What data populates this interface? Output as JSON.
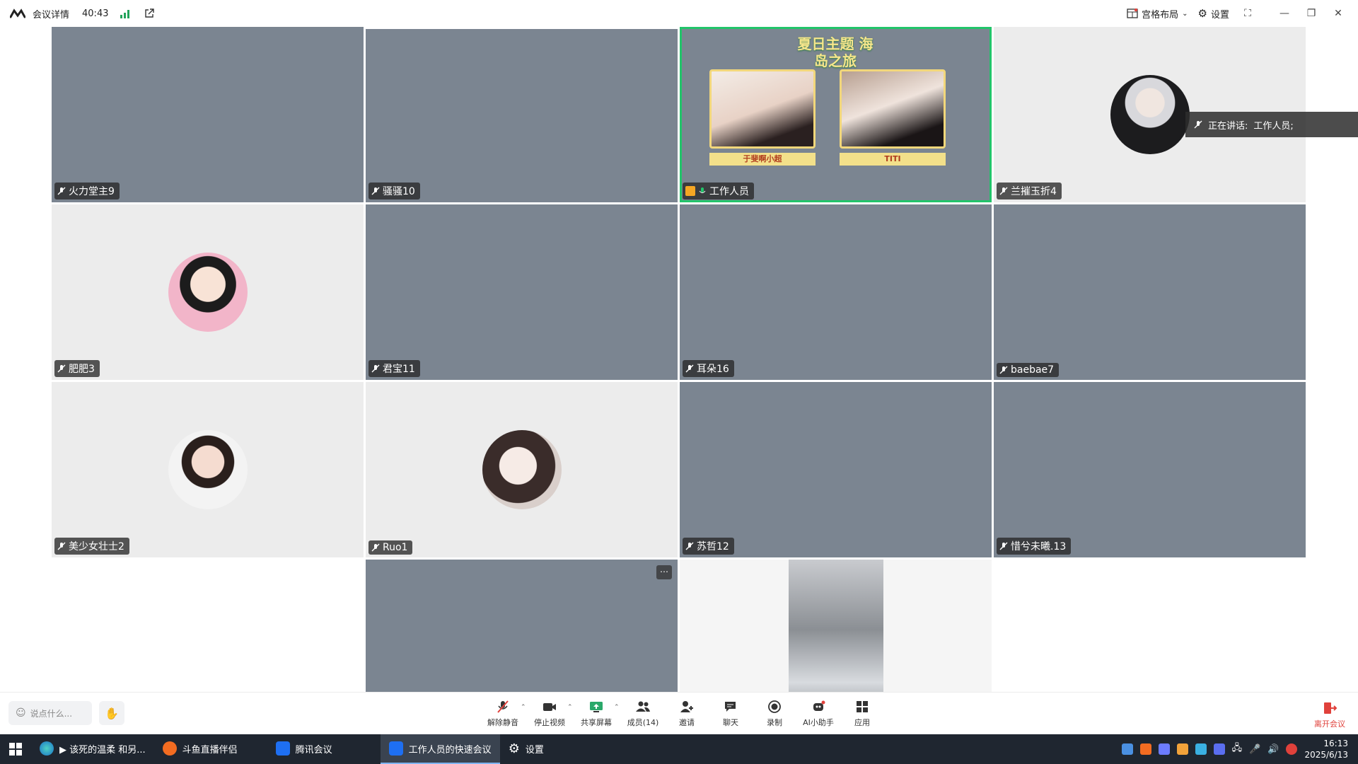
{
  "topbar": {
    "meeting_details_label": "会议详情",
    "elapsed_time": "40:43",
    "layout_label": "宫格布局",
    "settings_label": "设置"
  },
  "tiles": [
    {
      "name": "火力堂主9",
      "type": "video"
    },
    {
      "name": "骚骚10",
      "type": "video"
    },
    {
      "name": "工作人员",
      "type": "video",
      "active": true,
      "overlay": {
        "title": "夏日主题 海岛之旅",
        "left_label": "于斐啊小超",
        "right_label": "TITI"
      }
    },
    {
      "name": "兰摧玉折4",
      "type": "avatar"
    },
    {
      "name": "肥肥3",
      "type": "avatar"
    },
    {
      "name": "君宝11",
      "type": "video"
    },
    {
      "name": "耳朵16",
      "type": "video"
    },
    {
      "name": "baebae7",
      "type": "video"
    },
    {
      "name": "美少女壮士2",
      "type": "avatar"
    },
    {
      "name": "Ruo1",
      "type": "avatar"
    },
    {
      "name": "苏哲12",
      "type": "video"
    },
    {
      "name": "惜兮未曦.13",
      "type": "video"
    },
    {
      "name": "",
      "type": "video"
    },
    {
      "name": "",
      "type": "video"
    }
  ],
  "speaking_indicator": {
    "prefix": "正在讲话:",
    "speaker": "工作人员;"
  },
  "toolbar": {
    "chat_placeholder": "说点什么...",
    "tools": [
      {
        "label": "解除静音",
        "icon": "mic-muted-icon",
        "caret": true
      },
      {
        "label": "停止视频",
        "icon": "camera-icon",
        "caret": true
      },
      {
        "label": "共享屏幕",
        "icon": "share-screen-icon",
        "caret": true
      },
      {
        "label": "成员(14)",
        "icon": "members-icon",
        "caret": false
      },
      {
        "label": "邀请",
        "icon": "invite-icon",
        "caret": false
      },
      {
        "label": "聊天",
        "icon": "chat-icon",
        "caret": false
      },
      {
        "label": "录制",
        "icon": "record-icon",
        "caret": false
      },
      {
        "label": "AI小助手",
        "icon": "ai-assistant-icon",
        "caret": false
      },
      {
        "label": "应用",
        "icon": "apps-icon",
        "caret": false
      }
    ],
    "leave_label": "离开会议"
  },
  "taskbar": {
    "tasks": [
      {
        "label": "▶ 该死的温柔 和另...",
        "icon": "edge-icon",
        "active": false
      },
      {
        "label": "斗鱼直播伴侣",
        "icon": "douyu-icon",
        "active": false
      },
      {
        "label": "腾讯会议",
        "icon": "tencent-meeting-icon",
        "active": false
      },
      {
        "label": "工作人员的快速会议",
        "icon": "tencent-meeting-icon",
        "active": true
      },
      {
        "label": "设置",
        "icon": "settings-icon",
        "active": false
      }
    ],
    "time": "16:13",
    "date": "2025/6/13"
  },
  "colors": {
    "active_speaker": "#22c46a",
    "leave": "#e0413b",
    "taskbar": "#1f2630"
  }
}
